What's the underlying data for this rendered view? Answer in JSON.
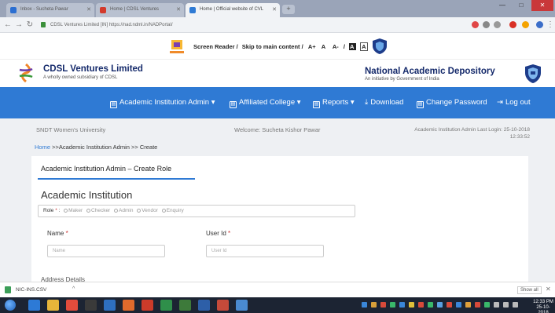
{
  "browser": {
    "tabs": [
      {
        "label": "Inbox - Sucheta Pawar",
        "active": false
      },
      {
        "label": "Home | CDSL Ventures",
        "active": false
      },
      {
        "label": "Home | Official website of CVL",
        "active": true
      }
    ],
    "new_tab": "+",
    "url": "CDSL Ventures Limited [IN]  https://nad.ndml.in/NADPortal/",
    "controls": {
      "minimize": "—",
      "maximize": "□",
      "close": "✕"
    }
  },
  "accessibility": {
    "screen_reader": "Screen Reader /",
    "skip": "Skip to main content /",
    "font_plus": "A+",
    "font_normal": "A",
    "font_minus": "A-",
    "separator": "/",
    "theme_dark": "A",
    "theme_light": "A"
  },
  "header": {
    "org_name": "CDSL Ventures Limited",
    "org_sub": "A wholly owned subsidiary of CDSL",
    "nad_name": "National Academic Depository",
    "nad_sub": "An initiative by Government of India"
  },
  "nav": [
    {
      "label": "Academic Institution Admin ▾"
    },
    {
      "label": "Affiliated College ▾"
    },
    {
      "label": "Reports ▾"
    },
    {
      "label": "Download"
    },
    {
      "label": "Change Password"
    },
    {
      "label": "Log out"
    }
  ],
  "info": {
    "institution": "SNDT Women's University",
    "welcome": "Welcome: Sucheta Kishor Pawar",
    "last_login_label": "Academic Institution Admin Last Login: 25-10-2018",
    "last_login_time": "12:33:52"
  },
  "breadcrumb": {
    "home": "Home",
    "rest": " >>Academic Institution Admin >> Create"
  },
  "form": {
    "tab_title": "Academic Institution Admin – Create Role",
    "section_title": "Academic Institution",
    "role_label": "Role",
    "role_required": "*",
    "role_options": [
      "Maker",
      "Checker",
      "Admin",
      "Vendor",
      "Enquiry"
    ],
    "name_label": "Name",
    "name_required": "*",
    "name_placeholder": "Name",
    "userid_label": "User Id",
    "userid_required": "*",
    "userid_placeholder": "User Id",
    "address_label": "Address Details"
  },
  "downloads": {
    "file": "NIC-INS.CSV",
    "caret": "^",
    "show_all": "Show all",
    "close": "✕"
  },
  "taskbar": {
    "time": "12:33 PM",
    "date": "25-10-2018"
  },
  "colors": {
    "nav_blue": "#2f7ad4",
    "brand_navy": "#152a6b",
    "content_bg": "#eef0f3"
  }
}
